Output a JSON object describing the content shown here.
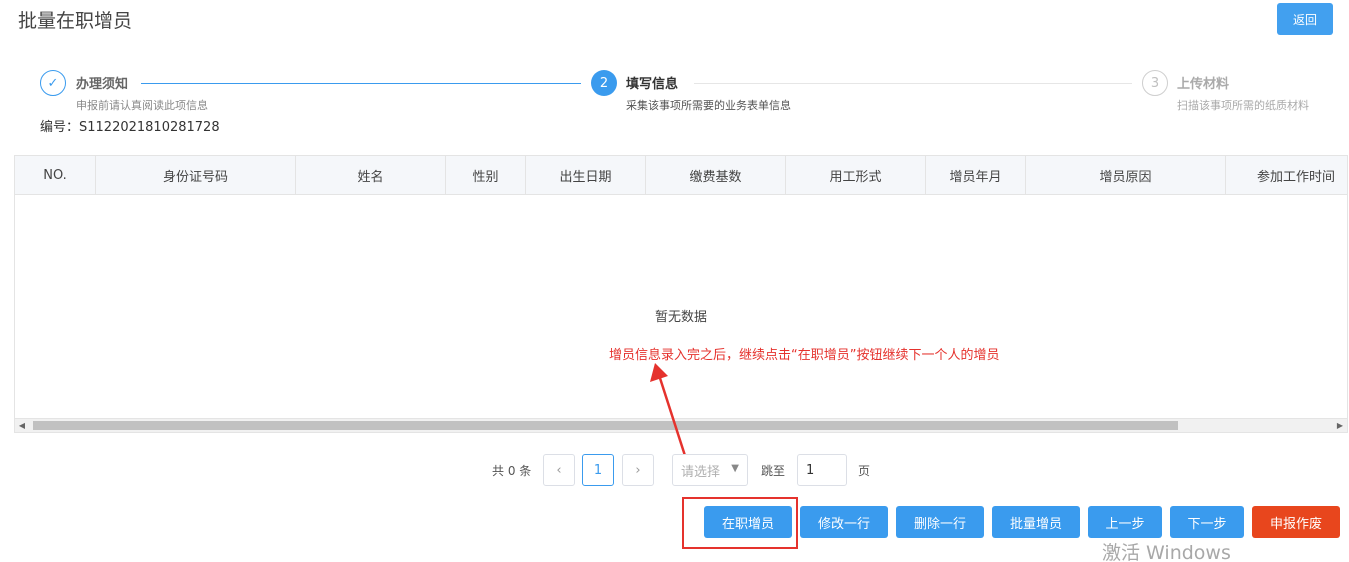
{
  "header": {
    "title": "批量在职增员",
    "back_label": "返回"
  },
  "steps": [
    {
      "index": "✓",
      "title": "办理须知",
      "desc": "申报前请认真阅读此项信息",
      "state": "done"
    },
    {
      "index": "2",
      "title": "填写信息",
      "desc": "采集该事项所需要的业务表单信息",
      "state": "active"
    },
    {
      "index": "3",
      "title": "上传材料",
      "desc": "扫描该事项所需的纸质材料",
      "state": "wait"
    }
  ],
  "record": {
    "label": "编号：",
    "value": "S1122021810281728"
  },
  "table": {
    "columns": [
      "NO.",
      "身份证号码",
      "姓名",
      "性别",
      "出生日期",
      "缴费基数",
      "用工形式",
      "增员年月",
      "增员原因",
      "参加工作时间"
    ],
    "empty_text": "暂无数据"
  },
  "annotation": {
    "text": "增员信息录入完之后，继续点击“在职增员”按钮继续下一个人的增员",
    "color": "#e5322d"
  },
  "pagination": {
    "total_label": "共 0 条",
    "prev_icon": "‹",
    "current_page": "1",
    "next_icon": "›",
    "page_size_placeholder": "请选择",
    "jump_label": "跳至",
    "jump_value": "1",
    "page_unit": "页"
  },
  "actions": {
    "add_employee": "在职增员",
    "edit_row": "修改一行",
    "delete_row": "删除一行",
    "batch_add": "批量增员",
    "prev_step": "上一步",
    "next_step": "下一步",
    "submit": "申报作废"
  },
  "colors": {
    "primary": "#3a9bee",
    "danger": "#e8461d"
  },
  "watermark": "激活 Windows"
}
